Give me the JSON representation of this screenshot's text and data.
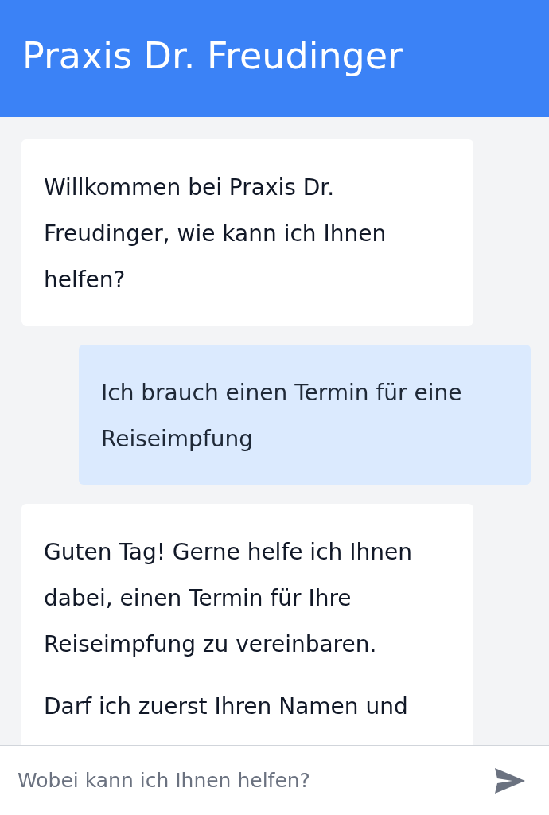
{
  "header": {
    "title": "Praxis Dr. Freudinger"
  },
  "messages": [
    {
      "kind": "bot",
      "paragraphs": [
        "Willkommen bei Praxis Dr. Freudinger, wie kann ich Ihnen helfen?"
      ]
    },
    {
      "kind": "user",
      "paragraphs": [
        "Ich brauch einen Termin für eine Reiseimpfung"
      ]
    },
    {
      "kind": "bot",
      "paragraphs": [
        "Guten Tag! Gerne helfe ich Ihnen dabei, einen Termin für Ihre Reiseimpfung zu vereinbaren.",
        "Darf ich zuerst Ihren Namen und"
      ]
    }
  ],
  "composer": {
    "placeholder": "Wobei kann ich Ihnen helfen?"
  }
}
